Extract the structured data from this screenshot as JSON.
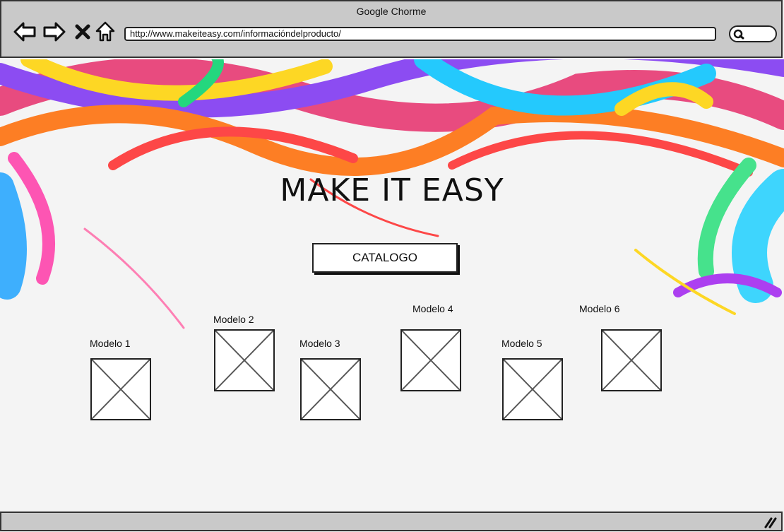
{
  "browser": {
    "title": "Google Chorme",
    "url": "http://www.makeiteasy.com/informacióndelproducto/",
    "icons": [
      "back-arrow-icon",
      "forward-arrow-icon",
      "close-icon",
      "home-icon",
      "search-icon"
    ]
  },
  "page": {
    "heading": "MAKE IT EASY",
    "catalog_button": "CATALOGO",
    "models": [
      {
        "label": "Modelo 1"
      },
      {
        "label": "Modelo 2"
      },
      {
        "label": "Modelo 3"
      },
      {
        "label": "Modelo 4"
      },
      {
        "label": "Modelo 5"
      },
      {
        "label": "Modelo 6"
      }
    ]
  },
  "colors": {
    "chrome": "#c9c9c9",
    "ink": "#222222",
    "background": "#f4f4f4"
  }
}
